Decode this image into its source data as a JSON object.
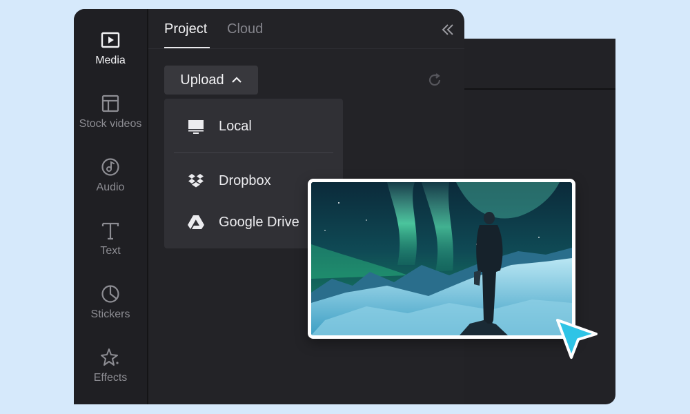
{
  "sidebar": {
    "items": [
      {
        "label": "Media",
        "icon": "play-square-icon",
        "active": true
      },
      {
        "label": "Stock videos",
        "icon": "layout-icon",
        "active": false
      },
      {
        "label": "Audio",
        "icon": "music-note-icon",
        "active": false
      },
      {
        "label": "Text",
        "icon": "text-t-icon",
        "active": false
      },
      {
        "label": "Stickers",
        "icon": "sticker-icon",
        "active": false
      },
      {
        "label": "Effects",
        "icon": "sparkle-icon",
        "active": false
      }
    ]
  },
  "tabs": [
    {
      "label": "Project",
      "active": true
    },
    {
      "label": "Cloud",
      "active": false
    }
  ],
  "upload": {
    "label": "Upload"
  },
  "upload_menu": {
    "items": [
      {
        "label": "Local",
        "icon": "monitor-icon"
      },
      {
        "label": "Dropbox",
        "icon": "dropbox-icon"
      },
      {
        "label": "Google Drive",
        "icon": "google-drive-icon"
      }
    ]
  },
  "colors": {
    "background": "#d6e9fb",
    "panel": "#232327",
    "rail": "#1f1f23",
    "menu": "#303035",
    "cursor_accent": "#2ec4e6"
  }
}
